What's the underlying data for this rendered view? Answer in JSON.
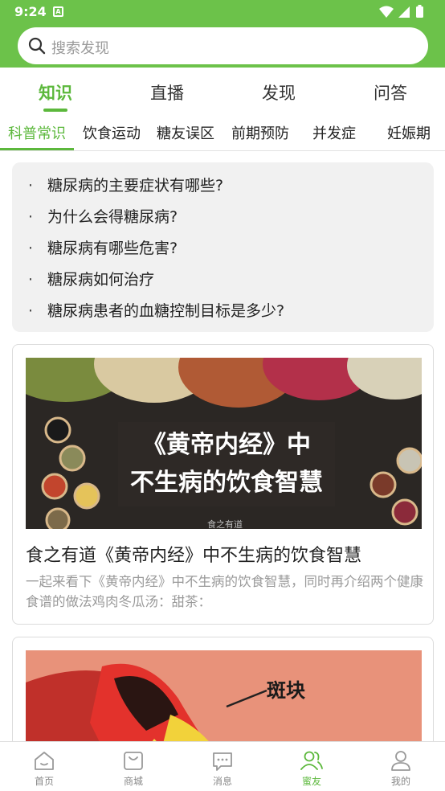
{
  "status_bar": {
    "time": "9:24",
    "notification_icon": "A"
  },
  "search": {
    "placeholder": "搜索发现"
  },
  "main_tabs": [
    {
      "label": "知识",
      "active": true
    },
    {
      "label": "直播",
      "active": false
    },
    {
      "label": "发现",
      "active": false
    },
    {
      "label": "问答",
      "active": false
    }
  ],
  "sub_tabs": [
    {
      "label": "科普常识",
      "active": true
    },
    {
      "label": "饮食运动",
      "active": false
    },
    {
      "label": "糖友误区",
      "active": false
    },
    {
      "label": "前期预防",
      "active": false
    },
    {
      "label": "并发症",
      "active": false
    },
    {
      "label": "妊娠期",
      "active": false
    }
  ],
  "faq": {
    "bullet": "·",
    "items": [
      "糖尿病的主要症状有哪些?",
      "为什么会得糖尿病?",
      "糖尿病有哪些危害?",
      "糖尿病如何治疗",
      "糖尿病患者的血糖控制目标是多少?"
    ]
  },
  "articles": [
    {
      "image_caption_line1": "《黄帝内经》中",
      "image_caption_line2": "不生病的饮食智慧",
      "image_watermark": "食之有道",
      "title": "食之有道《黄帝内经》中不生病的饮食智慧",
      "summary": "一起来看下《黄帝内经》中不生病的饮食智慧，同时再介绍两个健康食谱的做法鸡肉冬瓜汤：甜茶："
    },
    {
      "image_label": "斑块"
    }
  ],
  "bottom_nav": [
    {
      "label": "首页",
      "icon": "home-icon",
      "active": false
    },
    {
      "label": "商城",
      "icon": "shopping-bag-icon",
      "active": false
    },
    {
      "label": "消息",
      "icon": "message-icon",
      "active": false
    },
    {
      "label": "蜜友",
      "icon": "friends-icon",
      "active": true
    },
    {
      "label": "我的",
      "icon": "user-icon",
      "active": false
    }
  ],
  "colors": {
    "brand_green": "#6cc24a",
    "active_green": "#5cb83c"
  }
}
